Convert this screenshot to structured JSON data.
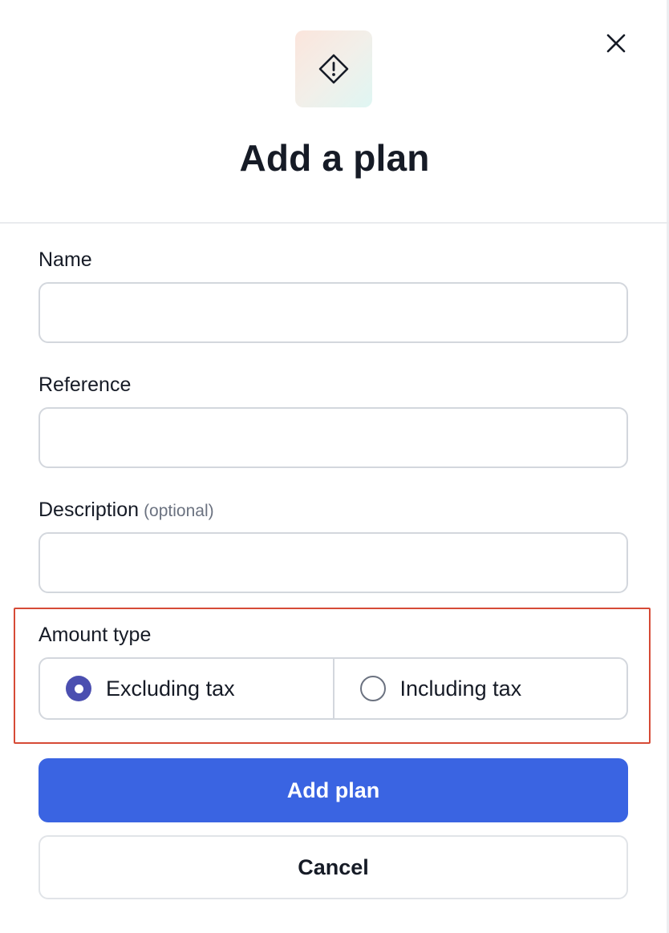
{
  "dialog": {
    "title": "Add a plan",
    "header_icon": "diamond-alert-icon",
    "close_icon": "close-icon"
  },
  "form": {
    "name": {
      "label": "Name",
      "value": "",
      "placeholder": ""
    },
    "reference": {
      "label": "Reference",
      "value": "",
      "placeholder": ""
    },
    "description": {
      "label": "Description",
      "optional_note": "(optional)",
      "value": "",
      "placeholder": ""
    },
    "amount_type": {
      "label": "Amount type",
      "options": [
        {
          "label": "Excluding tax",
          "selected": true
        },
        {
          "label": "Including tax",
          "selected": false
        }
      ]
    }
  },
  "actions": {
    "submit_label": "Add plan",
    "cancel_label": "Cancel"
  },
  "colors": {
    "primary": "#3a64e2",
    "radio_selected": "#4b4fb0",
    "highlight": "#d64a36",
    "text": "#161b26"
  }
}
